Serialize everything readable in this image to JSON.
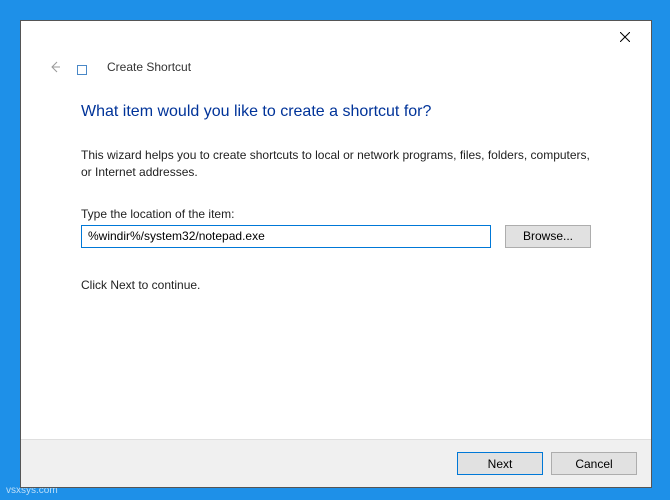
{
  "header": {
    "page_label": "Create Shortcut"
  },
  "main": {
    "heading": "What item would you like to create a shortcut for?",
    "description": "This wizard helps you to create shortcuts to local or network programs, files, folders, computers, or Internet addresses.",
    "location_label": "Type the location of the item:",
    "location_value": "%windir%/system32/notepad.exe",
    "browse_label": "Browse...",
    "hint": "Click Next to continue."
  },
  "footer": {
    "next_label": "Next",
    "cancel_label": "Cancel"
  },
  "watermark": "vsxsys.com"
}
